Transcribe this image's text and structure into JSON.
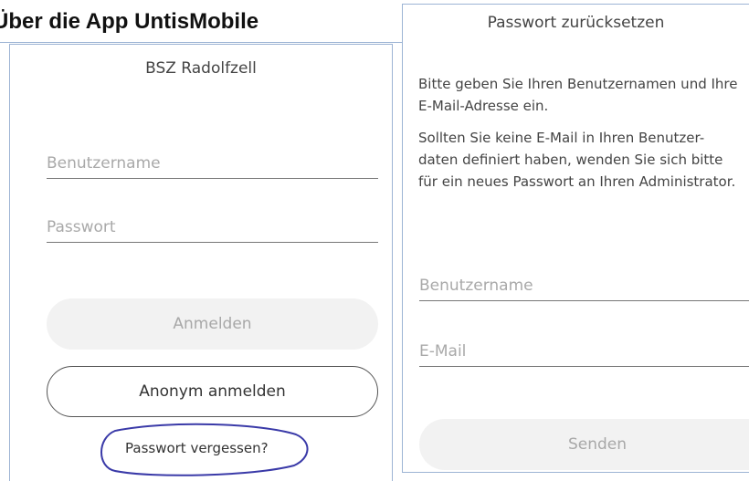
{
  "heading": "Über die App UntisMobile",
  "login": {
    "school_name": "BSZ Radolfzell",
    "username_placeholder": "Benutzername",
    "password_placeholder": "Passwort",
    "login_button": "Anmelden",
    "anonymous_button": "Anonym anmelden",
    "forgot_link": "Passwort vergessen?"
  },
  "reset": {
    "title": "Passwort zurücksetzen",
    "paragraph1": "Bitte geben Sie Ihren Benutzernamen und Ihre E-Mail-Adresse ein.",
    "paragraph2": "Sollten Sie keine E-Mail in Ihren Benutzer-daten definiert haben, wenden Sie sich bitte für ein neues Passwort an Ihren Administrator.",
    "username_placeholder": "Benutzername",
    "email_placeholder": "E-Mail",
    "send_button": "Senden"
  },
  "colors": {
    "annotation_circle": "#3a3aa8",
    "panel_border": "#9db4d4",
    "disabled_button_bg": "#f2f2f2"
  }
}
